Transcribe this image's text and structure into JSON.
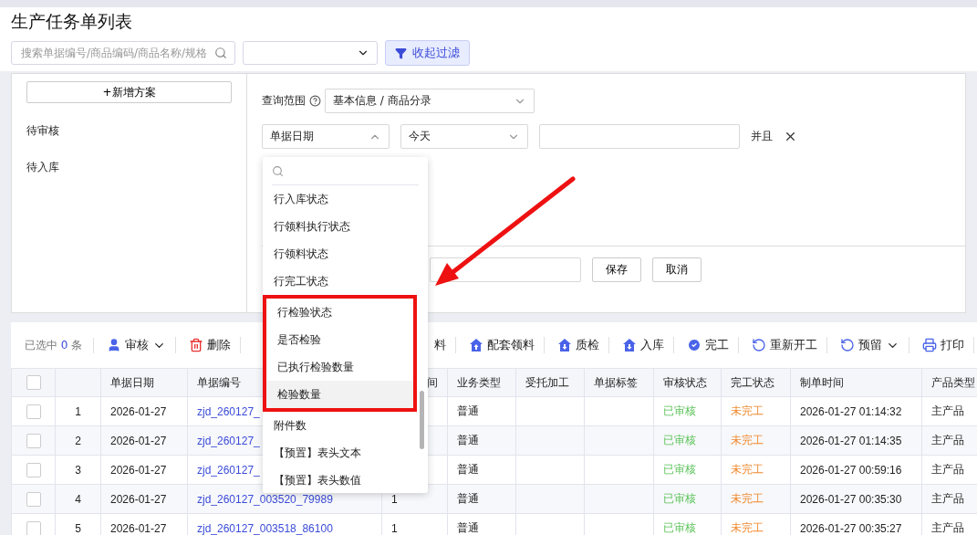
{
  "page_title": "生产任务单列表",
  "search": {
    "placeholder": "搜索单据编号/商品编码/商品名称/规格"
  },
  "collapse_filter_button": "收起过滤",
  "filter_panel": {
    "new_scheme_button": "+新增方案",
    "schemes": [
      {
        "label": "待审核",
        "selected": false
      },
      {
        "label": "待入库",
        "selected": false
      }
    ],
    "scope_label": "查询范围",
    "scope_value": "基本信息 / 商品分录",
    "condition": {
      "field": "单据日期",
      "expanded": true,
      "operator": "今天",
      "connector": "并且"
    },
    "save_button": "保存",
    "cancel_button": "取消"
  },
  "field_dropdown": {
    "items": [
      {
        "label": "行入库状态",
        "selected": false
      },
      {
        "label": "行领料执行状态",
        "selected": false
      },
      {
        "label": "行领料状态",
        "selected": false
      },
      {
        "label": "行完工状态",
        "selected": false
      },
      {
        "label": "行检验状态",
        "selected": false,
        "highlighted": true
      },
      {
        "label": "是否检验",
        "selected": false,
        "highlighted": true
      },
      {
        "label": "已执行检验数量",
        "selected": false,
        "highlighted": true
      },
      {
        "label": "检验数量",
        "selected": true,
        "highlighted": true
      },
      {
        "label": "附件数",
        "selected": false
      },
      {
        "label": "【预置】表头文本",
        "selected": false
      },
      {
        "label": "【预置】表头数值",
        "selected": false
      }
    ]
  },
  "toolbar": {
    "selected_prefix": "已选中",
    "selected_count": "0",
    "selected_suffix": "条",
    "actions": [
      {
        "kind": "user",
        "label": "审核",
        "menu": true
      },
      {
        "kind": "trash",
        "label": "删除",
        "menu": false
      },
      {
        "kind": "hidden",
        "label": "料",
        "menu": false
      },
      {
        "kind": "upload",
        "label": "配套领料",
        "menu": false
      },
      {
        "kind": "download",
        "label": "质检",
        "menu": false
      },
      {
        "kind": "download",
        "label": "入库",
        "menu": false
      },
      {
        "kind": "check",
        "label": "完工",
        "menu": false
      },
      {
        "kind": "restart",
        "label": "重新开工",
        "menu": false
      },
      {
        "kind": "restart",
        "label": "预留",
        "menu": true
      },
      {
        "kind": "print",
        "label": "打印",
        "menu": false
      }
    ]
  },
  "table": {
    "all_checked": false,
    "columns": [
      "",
      "单据日期",
      "单据编号",
      "间",
      "业务类型",
      "受托加工",
      "单据标签",
      "审核状态",
      "完工状态",
      "制单时间",
      "产品类型"
    ],
    "rows": [
      {
        "checked": false,
        "index": "1",
        "date": "2026-01-27",
        "number": "zjd_260127_",
        "business_type": "普通",
        "review_status": "已审核",
        "completion_status": "未完工",
        "created_time": "2026-01-27 01:14:32",
        "product_type": "主产品"
      },
      {
        "checked": false,
        "index": "2",
        "date": "2026-01-27",
        "number": "zjd_260127_",
        "business_type": "普通",
        "review_status": "已审核",
        "completion_status": "未完工",
        "created_time": "2026-01-27 01:14:35",
        "product_type": "主产品"
      },
      {
        "checked": false,
        "index": "3",
        "date": "2026-01-27",
        "number": "zjd_260127_",
        "business_type": "普通",
        "review_status": "已审核",
        "completion_status": "未完工",
        "created_time": "2026-01-27 00:59:16",
        "product_type": "主产品"
      },
      {
        "checked": false,
        "index": "4",
        "date": "2026-01-27",
        "number": "zjd_260127_003520_79989",
        "column_5": "1",
        "business_type": "普通",
        "review_status": "已审核",
        "completion_status": "未完工",
        "created_time": "2026-01-27 00:35:30",
        "product_type": "主产品"
      },
      {
        "checked": false,
        "index": "5",
        "date": "2026-01-27",
        "number": "zjd_260127_003518_86100",
        "column_5": "1",
        "business_type": "普通",
        "review_status": "已审核",
        "completion_status": "未完工",
        "created_time": "2026-01-27 00:35:27",
        "product_type": "主产品"
      }
    ]
  }
}
